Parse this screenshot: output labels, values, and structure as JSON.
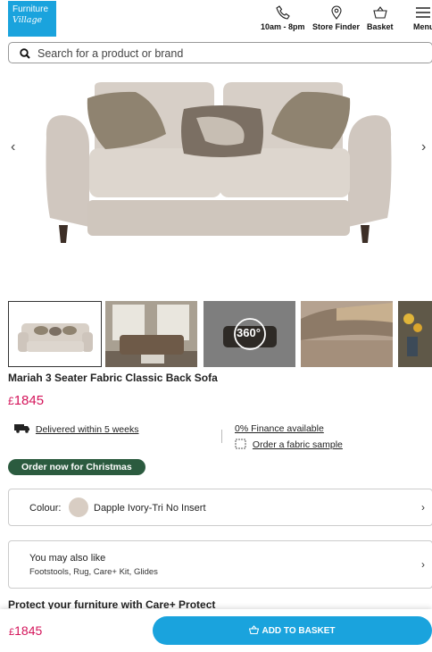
{
  "header": {
    "logo_line1": "Furniture",
    "logo_line2": "Village",
    "phone_label": "10am - 8pm",
    "store_label": "Store Finder",
    "basket_label": "Basket",
    "menu_label": "Menu"
  },
  "search": {
    "placeholder": "Search for a product or brand"
  },
  "gallery": {
    "thumbs": [
      "product-front",
      "room-scene",
      "360-view",
      "arm-detail",
      "decor-detail"
    ],
    "view_360_label": "360°"
  },
  "product": {
    "title": "Mariah 3 Seater Fabric Classic Back Sofa",
    "price_currency": "£",
    "price": "1845",
    "delivery": "Delivered within 5 weeks",
    "finance": "0% Finance available",
    "sample": "Order a fabric sample",
    "badge": "Order now for Christmas"
  },
  "colour": {
    "label": "Colour:",
    "value": "Dapple Ivory-Tri No Insert",
    "swatch": "#d8cdc3"
  },
  "also_like": {
    "title": "You may also like",
    "items": "Footstools, Rug, Care+ Kit, Glides"
  },
  "protect_heading": "Protect your furniture with Care+ Protect",
  "footer": {
    "price_currency": "£",
    "price": "1845",
    "add_label": "ADD TO BASKET"
  },
  "colors": {
    "accent": "#1aa3dd",
    "price": "#d4145a",
    "badge": "#2b5b3f"
  }
}
